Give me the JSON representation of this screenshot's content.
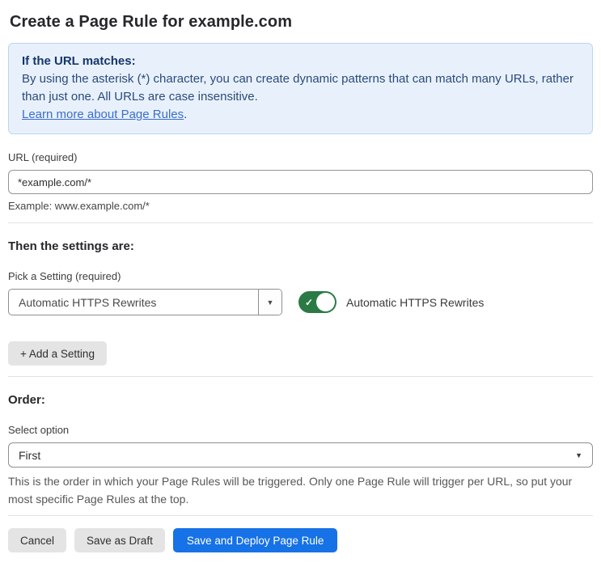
{
  "page": {
    "title": "Create a Page Rule for example.com"
  },
  "info_box": {
    "heading": "If the URL matches:",
    "body": "By using the asterisk (*) character, you can create dynamic patterns that can match many URLs, rather than just one. All URLs are case insensitive.",
    "link_text": "Learn more about Page Rules",
    "link_suffix": "."
  },
  "url_field": {
    "label": "URL (required)",
    "value": "*example.com/*",
    "example": "Example: www.example.com/*"
  },
  "settings_section": {
    "heading": "Then the settings are:",
    "picker_label": "Pick a Setting (required)",
    "picker_value": "Automatic HTTPS Rewrites",
    "toggle_label": "Automatic HTTPS Rewrites",
    "toggle_state": "on",
    "add_setting_label": "+ Add a Setting"
  },
  "order_section": {
    "heading": "Order:",
    "select_label": "Select option",
    "select_value": "First",
    "help_text": "This is the order in which your Page Rules will be triggered. Only one Page Rule will trigger per URL, so put your most specific Page Rules at the top."
  },
  "actions": {
    "cancel_label": "Cancel",
    "save_draft_label": "Save as Draft",
    "save_deploy_label": "Save and Deploy Page Rule"
  },
  "icons": {
    "dropdown_arrow": "▼",
    "select_chevron": "▼",
    "check": "✓"
  },
  "colors": {
    "primary_blue": "#1672e6",
    "toggle_green": "#2b7a45",
    "info_background": "#e8f1fb",
    "info_border": "#bcd6f3",
    "info_text": "#2b4a7d",
    "link_blue": "#3b6dd0"
  }
}
